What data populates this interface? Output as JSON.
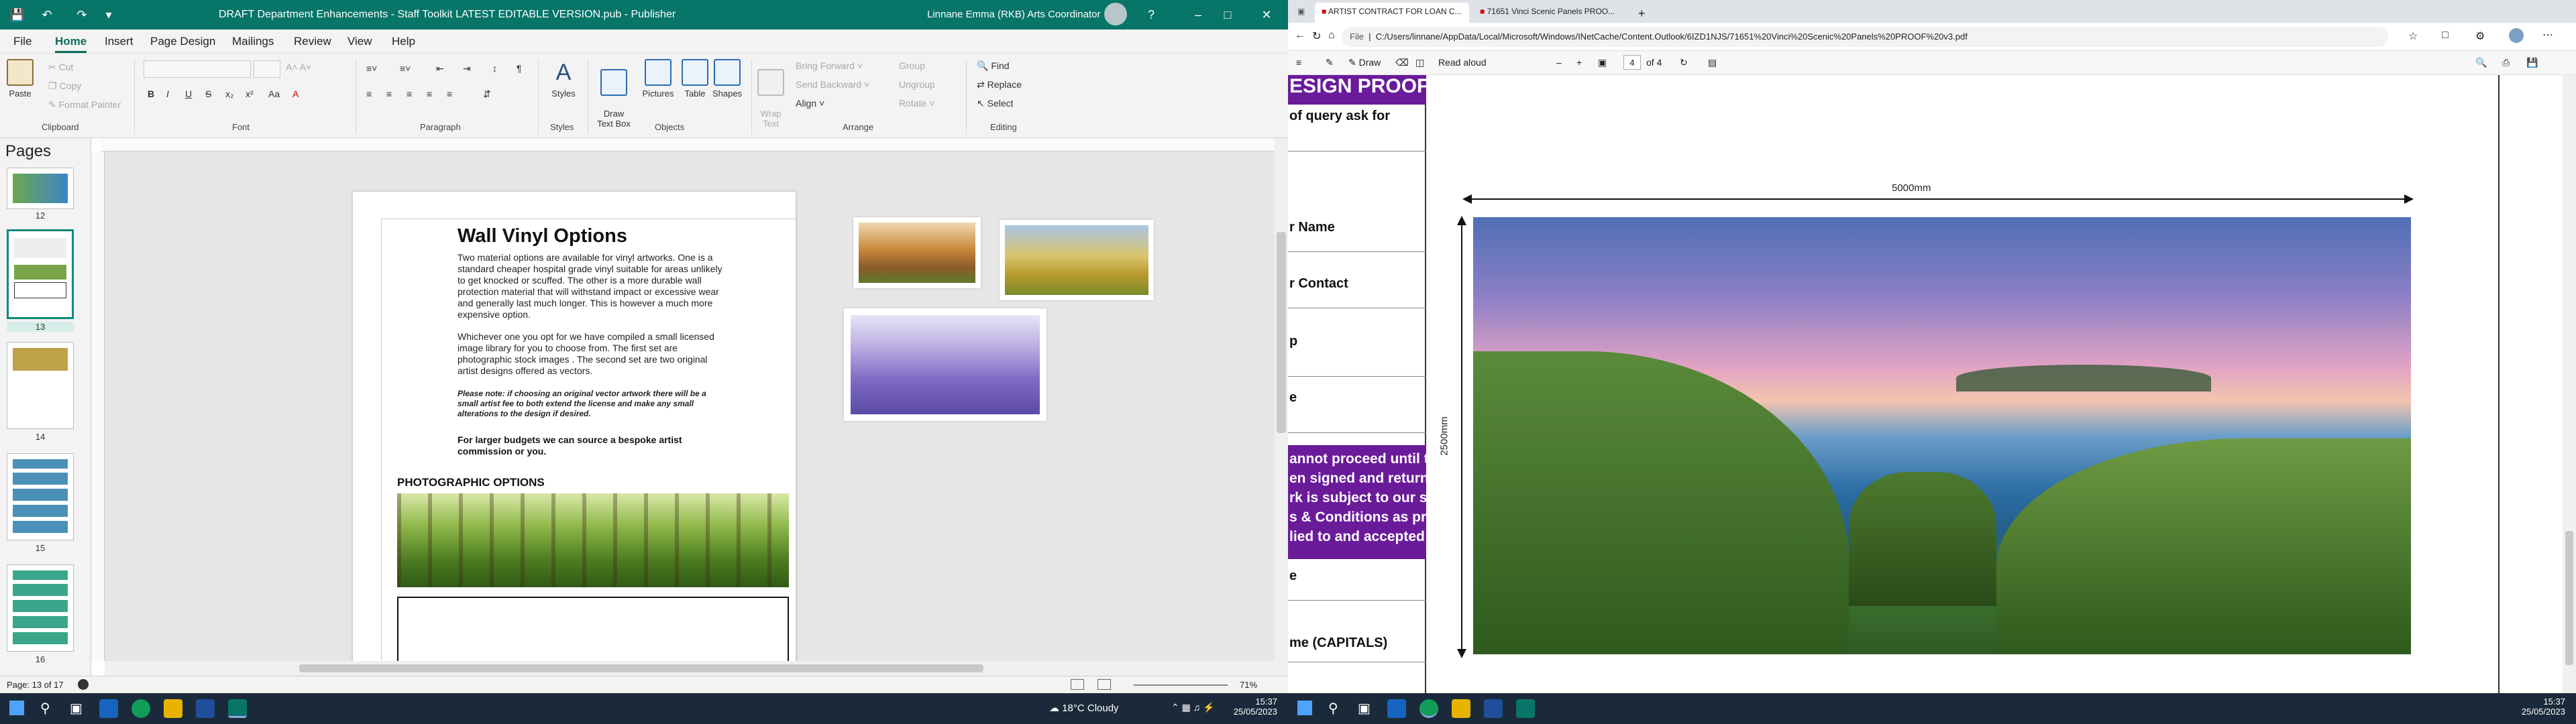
{
  "publisher": {
    "window_title": "DRAFT Department Enhancements - Staff Toolkit LATEST EDITABLE VERSION.pub  -  Publisher",
    "user": "Linnane Emma (RKB) Arts Coordinator",
    "tabs": [
      "File",
      "Home",
      "Insert",
      "Page Design",
      "Mailings",
      "Review",
      "View",
      "Help"
    ],
    "ribbon": {
      "clipboard": {
        "label": "Clipboard",
        "paste": "Paste",
        "cut": "Cut",
        "copy": "Copy",
        "format_painter": "Format Painter"
      },
      "font_label": "Font",
      "paragraph_label": "Paragraph",
      "styles": {
        "label": "Styles",
        "button": "Styles"
      },
      "objects": {
        "label": "Objects",
        "draw_text_box": "Draw\nText Box",
        "pictures": "Pictures",
        "table": "Table",
        "shapes": "Shapes"
      },
      "arrange": {
        "label": "Arrange",
        "wrap_text": "Wrap\nText",
        "bring_forward": "Bring Forward",
        "send_backward": "Send Backward",
        "align": "Align",
        "group": "Group",
        "ungroup": "Ungroup",
        "rotate": "Rotate"
      },
      "editing": {
        "label": "Editing",
        "find": "Find",
        "replace": "Replace",
        "select": "Select"
      }
    },
    "pages_pane": {
      "title": "Pages",
      "pages": [
        "12",
        "13",
        "14",
        "15",
        "16"
      ],
      "selected": "13"
    },
    "document": {
      "heading": "Wall Vinyl Options",
      "para1": "Two material options are available for vinyl artworks. One is a standard  cheaper hospital grade vinyl suitable for areas unlikely to get knocked or scuffed. The other is a more durable wall protection material that will withstand impact or excessive wear and generally last much longer. This is however a much more expensive option.",
      "para2": "Whichever one you opt for we have compiled a small licensed image library for you to choose from. The first set are photographic stock images . The second set are two original artist designs offered as vectors.",
      "note": "Please note: if choosing an original vector artwork there will be a small artist fee to both extend the license and make any small alterations to the design if desired.",
      "bespoke": "For larger budgets we can source a bespoke artist commission or you.",
      "section": "PHOTOGRAPHIC OPTIONS"
    },
    "status": {
      "page": "Page: 13 of 17",
      "zoom": "71%"
    }
  },
  "edge": {
    "tabs": [
      {
        "label": "ARTIST CONTRACT FOR LOAN C..."
      },
      {
        "label": "71651 Vinci Scenic Panels PROO..."
      }
    ],
    "address_prefix": "File",
    "url": "C:/Users/linnane/AppData/Local/Microsoft/Windows/INetCache/Content.Outlook/6IZD1NJS/71651%20Vinci%20Scenic%20Panels%20PROOF%20v3.pdf",
    "pdf_toolbar": {
      "draw": "Draw",
      "read_aloud": "Read aloud",
      "page_current": "4",
      "page_total": "of 4"
    },
    "proof": {
      "banner": "ESIGN PROOF",
      "rows": [
        "of query ask for",
        "r Name",
        "r Contact",
        "p",
        "e",
        "e",
        "me (CAPITALS)"
      ],
      "warning": "annot proceed until this form\nen signed and returned to us.\nrk is subject to our standard\ns & Conditions as previously\nlied to and accepted by you.",
      "width_label": "5000mm",
      "height_label": "2500mm"
    }
  },
  "taskbar_left": {
    "weather": "18°C  Cloudy",
    "time": "15:37",
    "date": "25/05/2023"
  },
  "taskbar_right": {
    "time": "15:37",
    "date": "25/05/2023"
  },
  "colors": {
    "publisher_accent": "#077568",
    "proof_purple": "#6a1b9a",
    "taskbar": "#1b2a3a"
  }
}
